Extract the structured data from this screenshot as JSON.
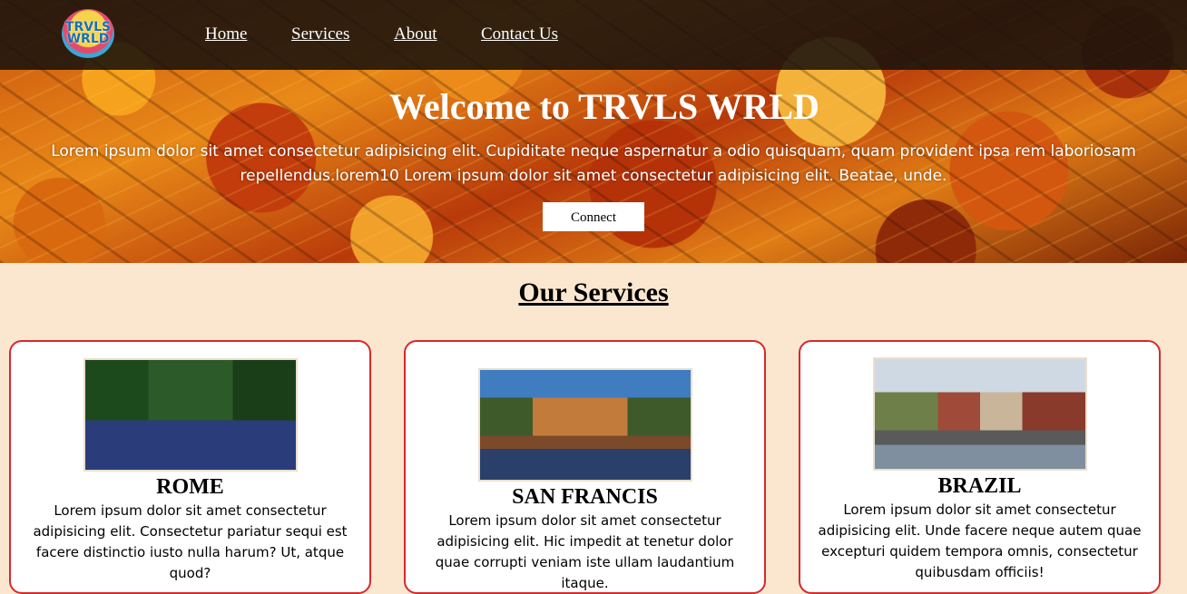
{
  "nav": {
    "logo_line1": "TRVLS",
    "logo_line2": "WRLD",
    "links": [
      "Home",
      "Services",
      "About",
      "Contact Us"
    ]
  },
  "hero": {
    "title": "Welcome to TRVLS WRLD",
    "text": "Lorem ipsum dolor sit amet consectetur adipisicing elit. Cupiditate neque aspernatur a odio quisquam, quam provident ipsa rem laboriosam repellendus.lorem10 Lorem ipsum dolor sit amet consectetur adipisicing elit. Beatae, unde.",
    "button": "Connect"
  },
  "services": {
    "title": "Our Services",
    "cards": [
      {
        "title": "ROME",
        "text": "Lorem ipsum dolor sit amet consectetur adipisicing elit. Consectetur pariatur sequi est facere distinctio iusto nulla harum? Ut, atque quod?"
      },
      {
        "title": "SAN FRANCIS",
        "text": "Lorem ipsum dolor sit amet consectetur adipisicing elit. Hic impedit at tenetur dolor quae corrupti veniam iste ullam laudantium itaque."
      },
      {
        "title": "BRAZIL",
        "text": "Lorem ipsum dolor sit amet consectetur adipisicing elit. Unde facere neque autem quae excepturi quidem tempora omnis, consectetur quibusdam officiis!"
      }
    ]
  }
}
